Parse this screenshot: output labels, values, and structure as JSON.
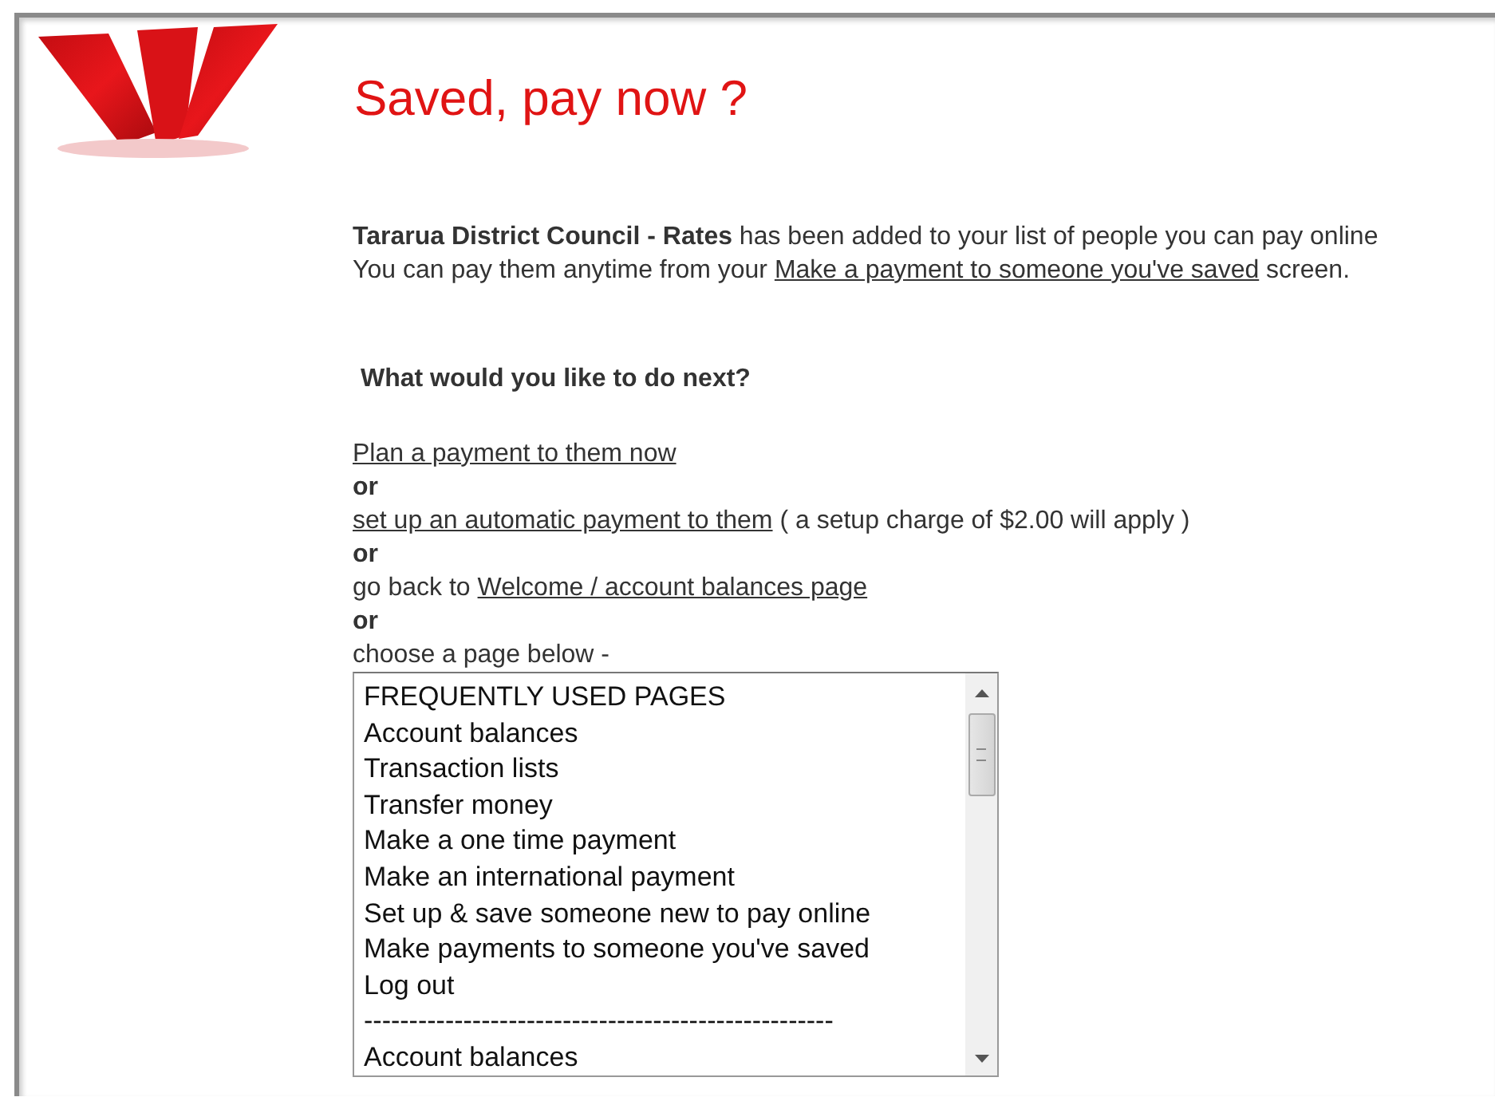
{
  "title": "Saved, pay now ?",
  "confirmation": {
    "message": "**Tararua District Council - Rates**   has been added to your list of people you can pay online",
    "prefix": "You can pay them anytime from your ",
    "link": "Make a payment to someone you've saved",
    "suffix": " screen."
  },
  "heading": "What would you like to do next?",
  "next_steps": [
    {
      "kind": "link",
      "link": "Plan a payment to them now"
    },
    {
      "kind": "or",
      "text": "or"
    },
    {
      "kind": "link",
      "link": "set up an automatic payment to them",
      "suffix": " ( a setup charge of $2.00 will apply )"
    },
    {
      "kind": "or",
      "text": "or"
    },
    {
      "kind": "link",
      "prefix": "go back to ",
      "link": "Welcome / account balances page"
    },
    {
      "kind": "or",
      "text": "or"
    },
    {
      "kind": "text",
      "text": "choose a page below -"
    }
  ],
  "page_list": {
    "items": [
      "FREQUENTLY USED PAGES",
      "Account balances",
      "Transaction lists",
      "Transfer money",
      "Make a one time payment",
      "Make an international payment",
      "Set up & save someone new to pay online",
      "Make payments to someone you've saved",
      "Log out",
      "----------------------------------------------------",
      "Account balances"
    ]
  }
}
